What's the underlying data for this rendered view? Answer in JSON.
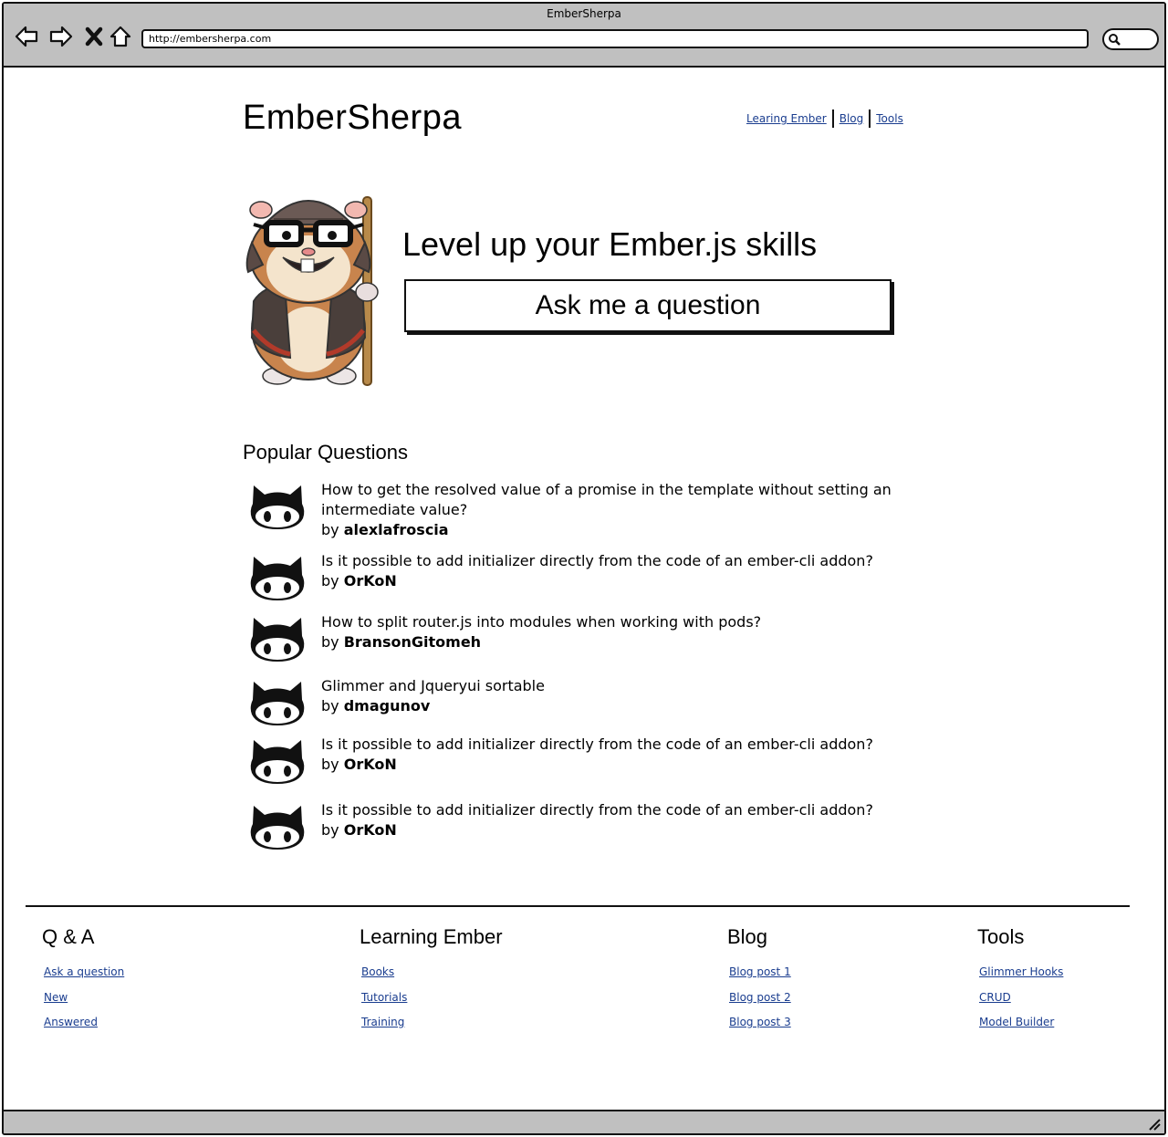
{
  "window": {
    "title": "EmberSherpa"
  },
  "browser": {
    "url": "http://embersherpa.com"
  },
  "site": {
    "logo": "EmberSherpa",
    "nav": [
      {
        "label": "Learing Ember"
      },
      {
        "label": "Blog"
      },
      {
        "label": "Tools"
      }
    ]
  },
  "hero": {
    "headline": "Level up your Ember.js skills",
    "cta": "Ask me a question"
  },
  "popular": {
    "title": "Popular Questions",
    "by_prefix": "by",
    "items": [
      {
        "question": "How to get the resolved value of a promise in the template without setting an intermediate value?",
        "author": "alexlafroscia"
      },
      {
        "question": "Is it possible to add initializer directly from the code of an ember-cli addon?",
        "author": "OrKoN"
      },
      {
        "question": "How to split router.js into modules when working with pods?",
        "author": "BransonGitomeh"
      },
      {
        "question": "Glimmer and Jqueryui sortable",
        "author": "dmagunov"
      },
      {
        "question": "Is it possible to add initializer directly from the code of an ember-cli addon?",
        "author": "OrKoN"
      },
      {
        "question": "Is it possible to add initializer directly from the code of an ember-cli addon?",
        "author": "OrKoN"
      }
    ]
  },
  "footer": {
    "columns": [
      {
        "title": "Q & A",
        "links": [
          "Ask a question",
          "New",
          "Answered"
        ]
      },
      {
        "title": "Learning Ember",
        "links": [
          "Books",
          "Tutorials",
          "Training"
        ]
      },
      {
        "title": "Blog",
        "links": [
          "Blog post 1",
          "Blog post 2",
          "Blog post 3"
        ]
      },
      {
        "title": "Tools",
        "links": [
          "Glimmer Hooks",
          "CRUD",
          "Model Builder"
        ]
      }
    ]
  },
  "icons": {
    "back": "back-arrow-icon",
    "forward": "forward-arrow-icon",
    "stop": "close-icon",
    "home": "home-icon",
    "search": "search-icon",
    "avatar": "octocat-icon",
    "mascot": "hamster-mascot-icon"
  },
  "colors": {
    "link": "#1a3d8f",
    "chrome": "#c0c0c0"
  }
}
